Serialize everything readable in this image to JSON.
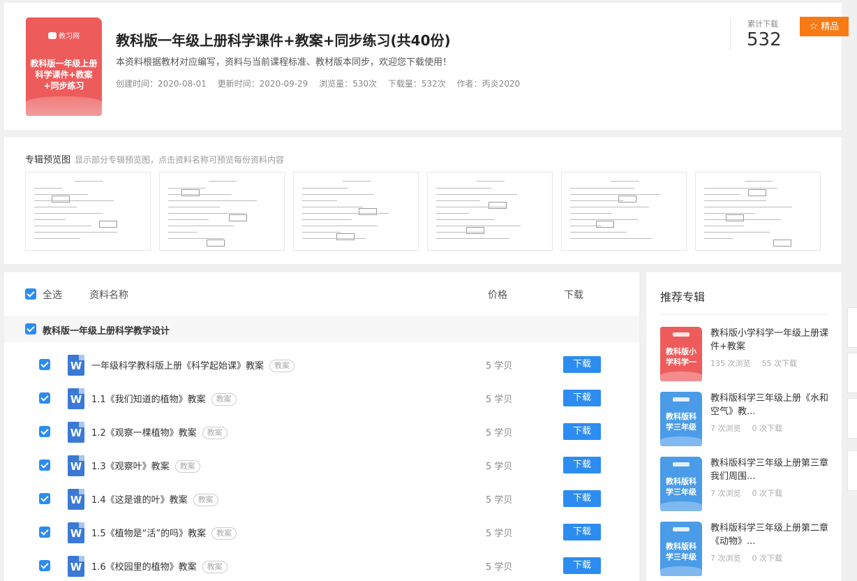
{
  "header": {
    "cover_logo": "教习网",
    "cover_text": "教科版一年级上册科学课件+教案+同步练习",
    "title": "教科版一年级上册科学课件+教案+同步练习(共40份)",
    "description": "本资料根据教材对应编写，资料与当前课程标准、教材版本同步，欢迎您下载使用！",
    "meta": {
      "created": "创建时间：2020-08-01",
      "updated": "更新时间：2020-09-29",
      "views": "浏览量：530次",
      "downloads": "下载量：532次",
      "author": "作者：丙炎2020"
    },
    "stat_label": "累计下载",
    "stat_value": "532",
    "badge": "精品"
  },
  "preview": {
    "title": "专辑预览图",
    "hint": "显示部分专辑预览图，点击资料名称可预览每份资料内容"
  },
  "list": {
    "select_all": "全选",
    "col_name": "资料名称",
    "col_price": "价格",
    "col_download": "下载",
    "group": "教科版一年级上册科学教学设计",
    "rows": [
      {
        "name": "一年级科学教科版上册《科学起始课》教案",
        "tag": "教案",
        "price": "5 学贝",
        "button": "下载"
      },
      {
        "name": "1.1《我们知道的植物》教案",
        "tag": "教案",
        "price": "5 学贝",
        "button": "下载"
      },
      {
        "name": "1.2《观察一棵植物》教案",
        "tag": "教案",
        "price": "5 学贝",
        "button": "下载"
      },
      {
        "name": "1.3《观察叶》教案",
        "tag": "教案",
        "price": "5 学贝",
        "button": "下载"
      },
      {
        "name": "1.4《这是谁的叶》教案",
        "tag": "教案",
        "price": "5 学贝",
        "button": "下载"
      },
      {
        "name": "1.5《植物是“活”的吗》教案",
        "tag": "教案",
        "price": "5 学贝",
        "button": "下载"
      },
      {
        "name": "1.6《校园里的植物》教案",
        "tag": "教案",
        "price": "5 学贝",
        "button": "下载"
      }
    ]
  },
  "recommend": {
    "title": "推荐专辑",
    "items": [
      {
        "cover_text": "教科版小学科学一",
        "name": "教科版小学科学一年级上册课件+教案",
        "views": "135 次浏览",
        "downloads": "55 次下载",
        "color": "#ee5b5b"
      },
      {
        "cover_text": "教科版科学三年级",
        "name": "教科版科学三年级上册《水和空气》教...",
        "views": "7 次浏览",
        "downloads": "0 次下载",
        "color": "#4a9be8"
      },
      {
        "cover_text": "教科版科学三年级",
        "name": "教科版科学三年级上册第三章我们周围...",
        "views": "7 次浏览",
        "downloads": "0 次下载",
        "color": "#4a9be8"
      },
      {
        "cover_text": "教科版科学三年级",
        "name": "教科版科学三年级上册第二章《动物》...",
        "views": "7 次浏览",
        "downloads": "0 次下载",
        "color": "#4a9be8"
      }
    ]
  },
  "colors": {
    "accent": "#2d8cf0",
    "badge": "#f87a14",
    "cover_red": "#ee5b5b",
    "cover_blue": "#4a9be8"
  }
}
